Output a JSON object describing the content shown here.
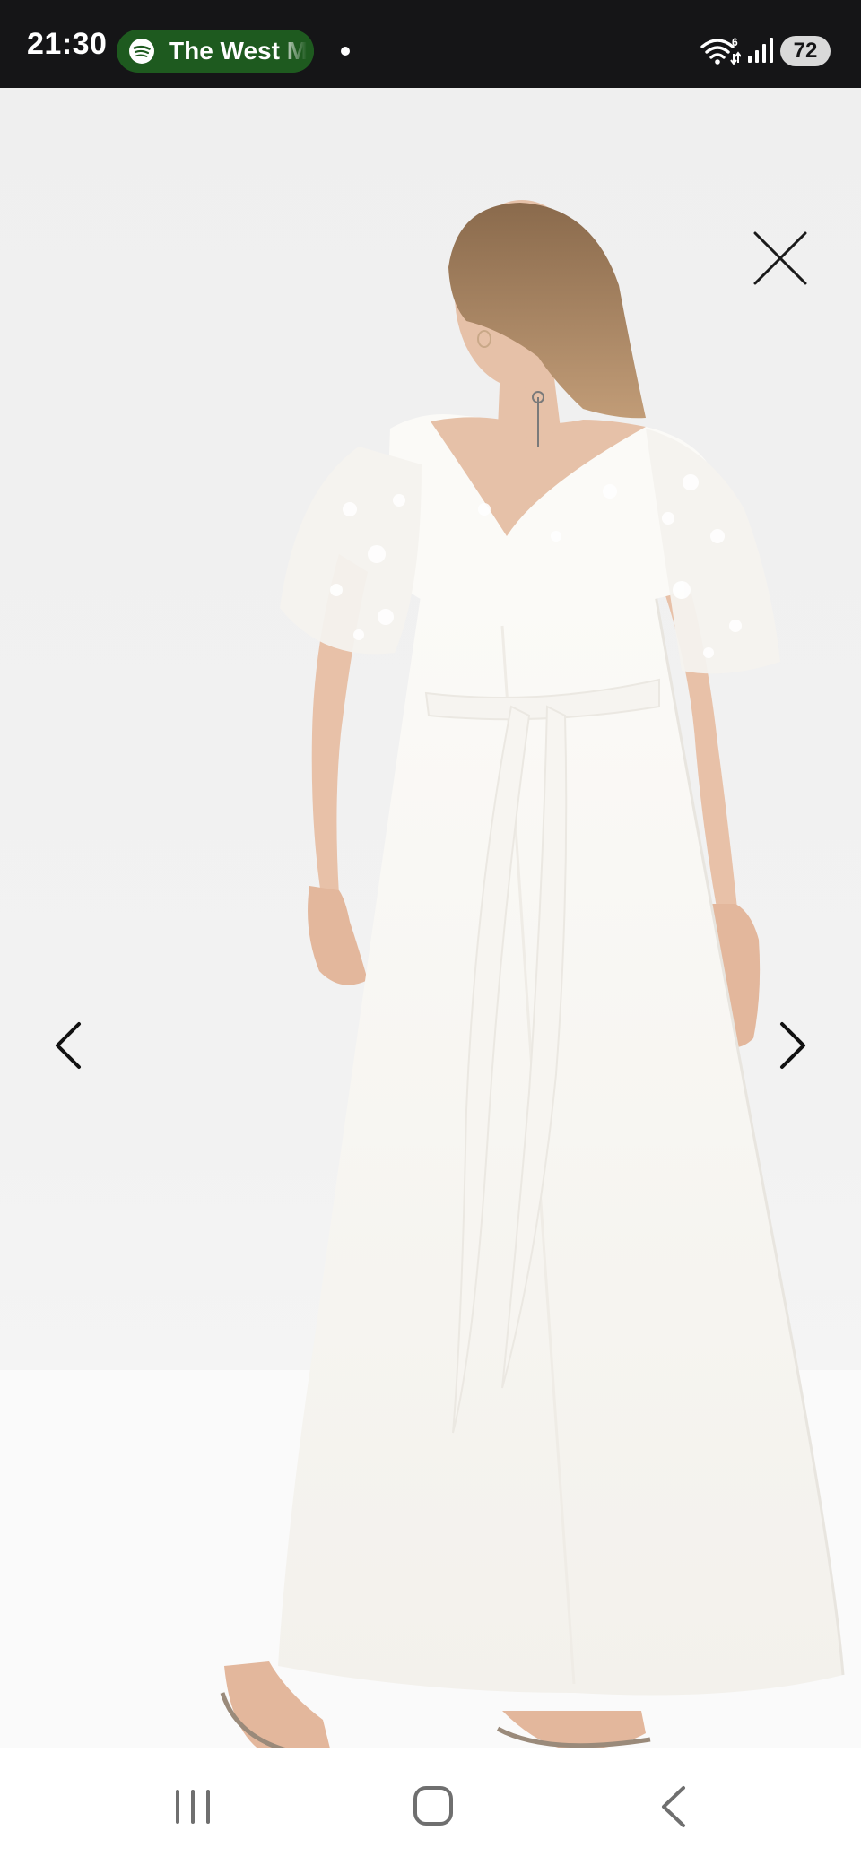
{
  "status_bar": {
    "time": "21:30",
    "media_chip": {
      "app_icon": "spotify-icon",
      "label": "The West M",
      "color": "#1e5a1f"
    },
    "wifi_badge": "6",
    "battery": "72"
  },
  "viewer": {
    "close_icon": "close-icon",
    "prev_icon": "chevron-left-icon",
    "next_icon": "chevron-right-icon",
    "photo_subject": "product-photo"
  },
  "nav_bar": {
    "recents_icon": "recents-icon",
    "home_icon": "home-icon",
    "back_icon": "back-icon"
  }
}
